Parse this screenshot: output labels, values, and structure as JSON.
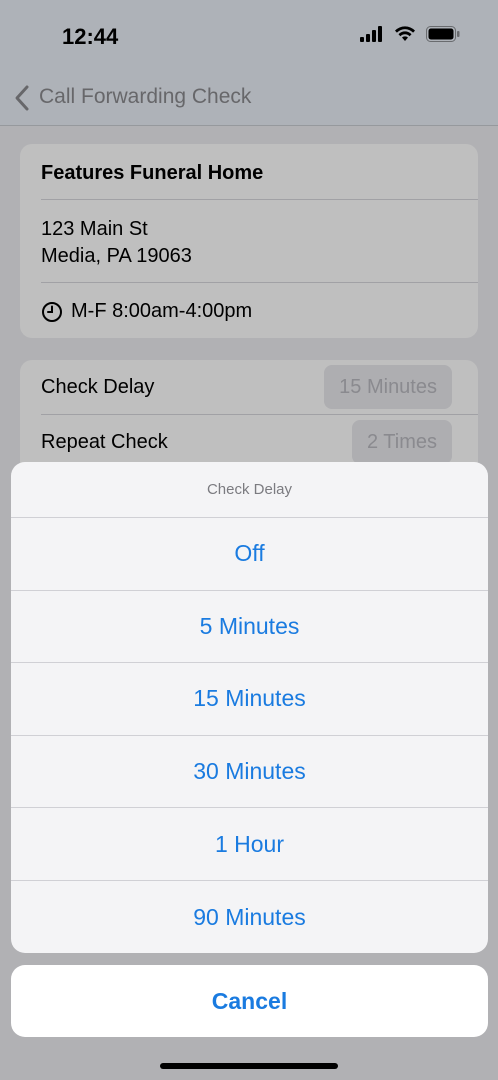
{
  "status_bar": {
    "time": "12:44",
    "icons": [
      "cellular-signal-icon",
      "wifi-icon",
      "battery-icon"
    ]
  },
  "nav": {
    "title": "Call Forwarding Check",
    "back_icon": "chevron-left-icon"
  },
  "location": {
    "name": "Features Funeral Home",
    "address_line1": "123 Main St",
    "address_line2": "Media, PA 19063",
    "hours": "M-F 8:00am-4:00pm",
    "hours_icon": "clock-icon"
  },
  "settings": {
    "check_delay_label": "Check Delay",
    "check_delay_value": "15 Minutes",
    "repeat_check_label": "Repeat Check",
    "repeat_check_value": "2 Times"
  },
  "action_sheet": {
    "title": "Check Delay",
    "options": [
      "Off",
      "5 Minutes",
      "15 Minutes",
      "30 Minutes",
      "1 Hour",
      "90 Minutes"
    ],
    "cancel_label": "Cancel"
  },
  "colors": {
    "accent": "#1a7be0",
    "nav_background": "#e9eef6"
  }
}
